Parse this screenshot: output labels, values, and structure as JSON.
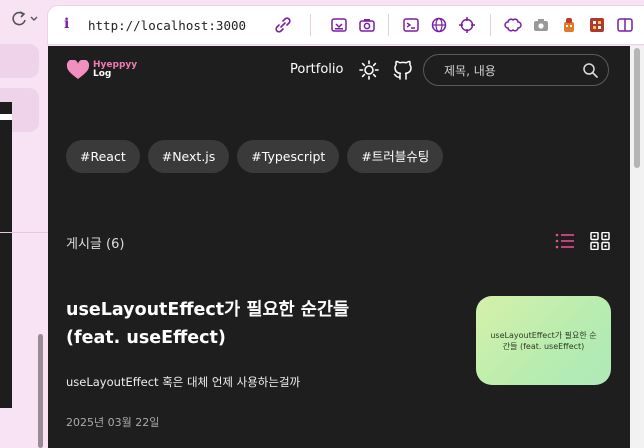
{
  "browser": {
    "url": "http://localhost:3000",
    "colors": {
      "chrome_bg": "#f7e3f4",
      "icon_accent": "#7a1fa2"
    },
    "toolbar_icons": [
      "link-icon",
      "save-icon",
      "screenshot-icon",
      "terminal-icon",
      "globe-icon",
      "target-icon",
      "extension-icon",
      "camera-icon",
      "pet-icon",
      "puzzle-icon",
      "sidebar-icon"
    ]
  },
  "site": {
    "logo": {
      "line1": "Hyeppyy",
      "line2": "Log",
      "brand_color": "#f27bb3"
    },
    "nav": {
      "portfolio": "Portfolio"
    },
    "search": {
      "placeholder": "제목, 내용"
    },
    "tags": [
      "#React",
      "#Next.js",
      "#Typescript",
      "#트러블슈팅"
    ],
    "post_count_label": "게시글 (6)",
    "active_view_color": "#e84a93",
    "post": {
      "title": "useLayoutEffect가 필요한 순간들 (feat. useEffect)",
      "description": "useLayoutEffect 혹은 대체 언제 사용하는걸까",
      "date": "2025년 03월 22일",
      "thumbnail_text": "useLayoutEffect가 필요한 순간들 (feat. useEffect)"
    }
  }
}
